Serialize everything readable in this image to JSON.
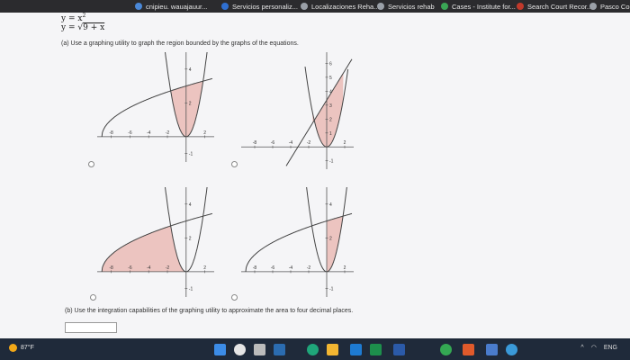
{
  "bookmarks": [
    {
      "label": "cnipieu. wauajauur...",
      "color": "#4a88d8"
    },
    {
      "label": "Servicios personaliz...",
      "color": "#2f6fd0"
    },
    {
      "label": "Localizaciones Reha...",
      "color": "#9aa0a8"
    },
    {
      "label": "Servicios rehab",
      "color": "#9aa0a8"
    },
    {
      "label": "Cases - Institute for...",
      "color": "#3aa655"
    },
    {
      "label": "Search Court Recor...",
      "color": "#c0392b"
    },
    {
      "label": "Pasco Count",
      "color": "#9aa0a8"
    }
  ],
  "problem": {
    "eq1_lhs": "y = x",
    "eq1_exp": "2",
    "eq2_lhs": "y = ",
    "eq2_root": "9 + x",
    "part_a": "(a) Use a graphing utility to graph the region bounded by the graphs of the equations.",
    "part_b": "(b) Use the integration capabilities of the graphing utility to approximate the area to four decimal places."
  },
  "graphs": [
    {
      "id": "graph1",
      "xticks": [
        {
          "v": -8,
          "t": "-8"
        },
        {
          "v": -6,
          "t": "-6"
        },
        {
          "v": -4,
          "t": "-4"
        },
        {
          "v": -2,
          "t": "-2"
        },
        {
          "v": 2,
          "t": "2"
        }
      ],
      "yticks": [
        {
          "v": 4,
          "t": "4"
        },
        {
          "v": 2,
          "t": "2"
        },
        {
          "v": -1,
          "t": "-1"
        }
      ]
    },
    {
      "id": "graph2",
      "xticks": [
        {
          "v": -8,
          "t": "-8"
        },
        {
          "v": -6,
          "t": "-6"
        },
        {
          "v": -4,
          "t": "-4"
        },
        {
          "v": -2,
          "t": "-2"
        },
        {
          "v": 2,
          "t": "2"
        }
      ],
      "yticks": [
        {
          "v": 6,
          "t": "6"
        },
        {
          "v": 5,
          "t": "5"
        },
        {
          "v": 4,
          "t": "4"
        },
        {
          "v": 3,
          "t": "3"
        },
        {
          "v": 2,
          "t": "2"
        },
        {
          "v": 1,
          "t": "1"
        },
        {
          "v": -1,
          "t": "-1"
        }
      ]
    },
    {
      "id": "graph3",
      "xticks": [
        {
          "v": -8,
          "t": "-8"
        },
        {
          "v": -6,
          "t": "-6"
        },
        {
          "v": -4,
          "t": "-4"
        },
        {
          "v": -2,
          "t": "-2"
        },
        {
          "v": 2,
          "t": "2"
        }
      ],
      "yticks": [
        {
          "v": 4,
          "t": "4"
        },
        {
          "v": 2,
          "t": "2"
        },
        {
          "v": -1,
          "t": "-1"
        }
      ]
    },
    {
      "id": "graph4",
      "xticks": [
        {
          "v": -8,
          "t": "-8"
        },
        {
          "v": -6,
          "t": "-6"
        },
        {
          "v": -4,
          "t": "-4"
        },
        {
          "v": -2,
          "t": "-2"
        },
        {
          "v": 2,
          "t": "2"
        }
      ],
      "yticks": [
        {
          "v": 4,
          "t": "4"
        },
        {
          "v": 2,
          "t": "2"
        },
        {
          "v": -1,
          "t": "-1"
        }
      ]
    }
  ],
  "answer": {
    "value": ""
  },
  "taskbar": {
    "weather": "87°F",
    "icons": [
      "windows-icon",
      "search-icon",
      "files-icon",
      "app-icon",
      "edge-icon",
      "folder-icon",
      "store-icon",
      "excel-icon",
      "word-icon",
      "chrome-icon",
      "app2-icon",
      "app3-icon",
      "browser-icon"
    ],
    "lang": "ENG"
  }
}
